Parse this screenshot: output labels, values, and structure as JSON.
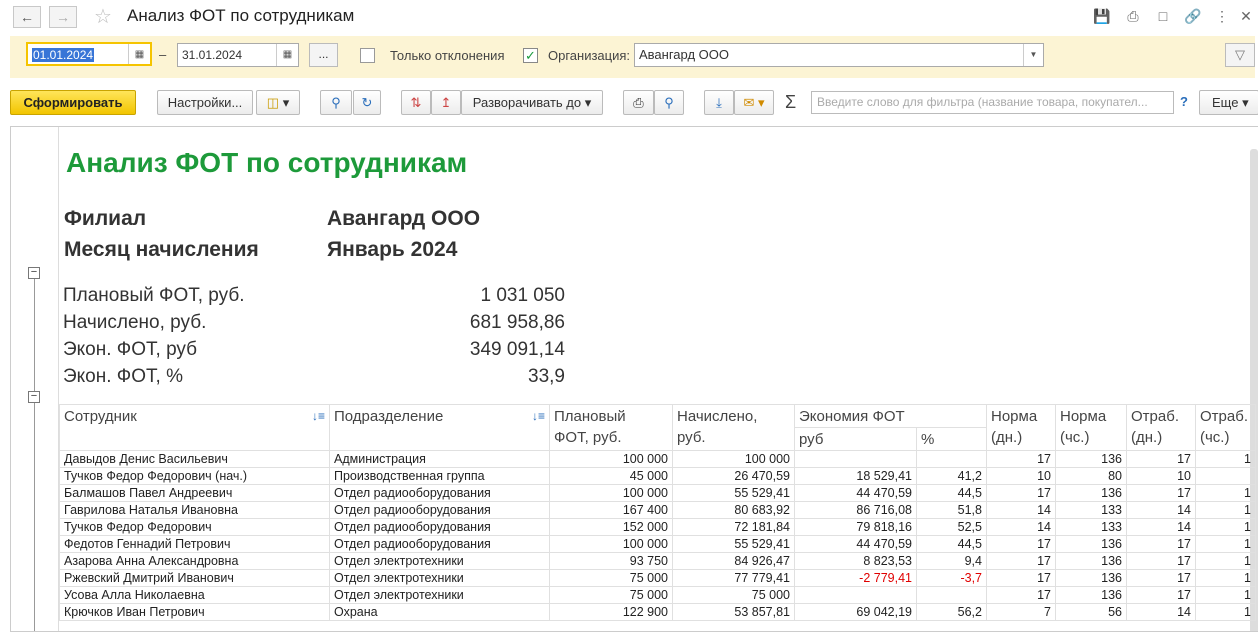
{
  "window": {
    "title": "Анализ ФОТ по сотрудникам"
  },
  "params": {
    "date_from": "01.01.2024",
    "date_sep": "–",
    "date_to": "31.01.2024",
    "dots": "...",
    "only_deviations_label": "Только отклонения",
    "only_deviations_checked": false,
    "org_checked": true,
    "org_label": "Организация:",
    "org_value": "Авангард ООО"
  },
  "toolbar": {
    "generate": "Сформировать",
    "settings": "Настройки...",
    "expand_to": "Разворачивать до",
    "filter_placeholder": "Введите слово для фильтра (название товара, покупател...",
    "help": "?",
    "more": "Еще"
  },
  "report": {
    "title": "Анализ ФОТ по сотрудникам",
    "branch_label": "Филиал",
    "branch_value": "Авангард ООО",
    "month_label": "Месяц начисления",
    "month_value": "Январь 2024",
    "summary": [
      {
        "label": "Плановый ФОТ, руб.",
        "value": "1 031 050"
      },
      {
        "label": "Начислено, руб.",
        "value": "681 958,86"
      },
      {
        "label": "Экон. ФОТ, руб",
        "value": "349 091,14"
      },
      {
        "label": "Экон. ФОТ, %",
        "value": "33,9"
      }
    ],
    "headers": {
      "employee": "Сотрудник",
      "department": "Подразделение",
      "plan_1": "Плановый",
      "plan_2": "ФОТ, руб.",
      "accrued_1": "Начислено,",
      "accrued_2": "руб.",
      "savings": "Экономия ФОТ",
      "savings_rub": "руб",
      "savings_pct": "%",
      "norm_days_1": "Норма",
      "norm_days_2": "(дн.)",
      "norm_hours_1": "Норма",
      "norm_hours_2": "(чс.)",
      "worked_days_1": "Отраб.",
      "worked_days_2": "(дн.)",
      "worked_hours_1": "Отраб.",
      "worked_hours_2": "(чс.)"
    },
    "rows": [
      [
        "Давыдов Денис Васильевич",
        "Администрация",
        "100 000",
        "100 000",
        "",
        "",
        "17",
        "136",
        "17",
        "1"
      ],
      [
        "Тучков Федор Федорович (нач.)",
        "Производственная группа",
        "45 000",
        "26 470,59",
        "18 529,41",
        "41,2",
        "10",
        "80",
        "10",
        ""
      ],
      [
        "Балмашов Павел Андреевич",
        "Отдел радиооборудования",
        "100 000",
        "55 529,41",
        "44 470,59",
        "44,5",
        "17",
        "136",
        "17",
        "1"
      ],
      [
        "Гаврилова Наталья Ивановна",
        "Отдел радиооборудования",
        "167 400",
        "80 683,92",
        "86 716,08",
        "51,8",
        "14",
        "133",
        "14",
        "1"
      ],
      [
        "Тучков Федор Федорович",
        "Отдел радиооборудования",
        "152 000",
        "72 181,84",
        "79 818,16",
        "52,5",
        "14",
        "133",
        "14",
        "1"
      ],
      [
        "Федотов Геннадий Петрович",
        "Отдел радиооборудования",
        "100 000",
        "55 529,41",
        "44 470,59",
        "44,5",
        "17",
        "136",
        "17",
        "1"
      ],
      [
        "Азарова Анна Александровна",
        "Отдел электротехники",
        "93 750",
        "84 926,47",
        "8 823,53",
        "9,4",
        "17",
        "136",
        "17",
        "1"
      ],
      [
        "Ржевский Дмитрий Иванович",
        "Отдел электротехники",
        "75 000",
        "77 779,41",
        "-2 779,41",
        "-3,7",
        "17",
        "136",
        "17",
        "1"
      ],
      [
        "Усова Алла Николаевна",
        "Отдел электротехники",
        "75 000",
        "75 000",
        "",
        "",
        "17",
        "136",
        "17",
        "1"
      ],
      [
        "Крючков Иван Петрович",
        "Охрана",
        "122 900",
        "53 857,81",
        "69 042,19",
        "56,2",
        "7",
        "56",
        "14",
        "1"
      ]
    ]
  },
  "colors": {
    "title_green": "#1d9a3a",
    "negative_red": "#e00000",
    "primary_yellow": "#f2c500"
  }
}
